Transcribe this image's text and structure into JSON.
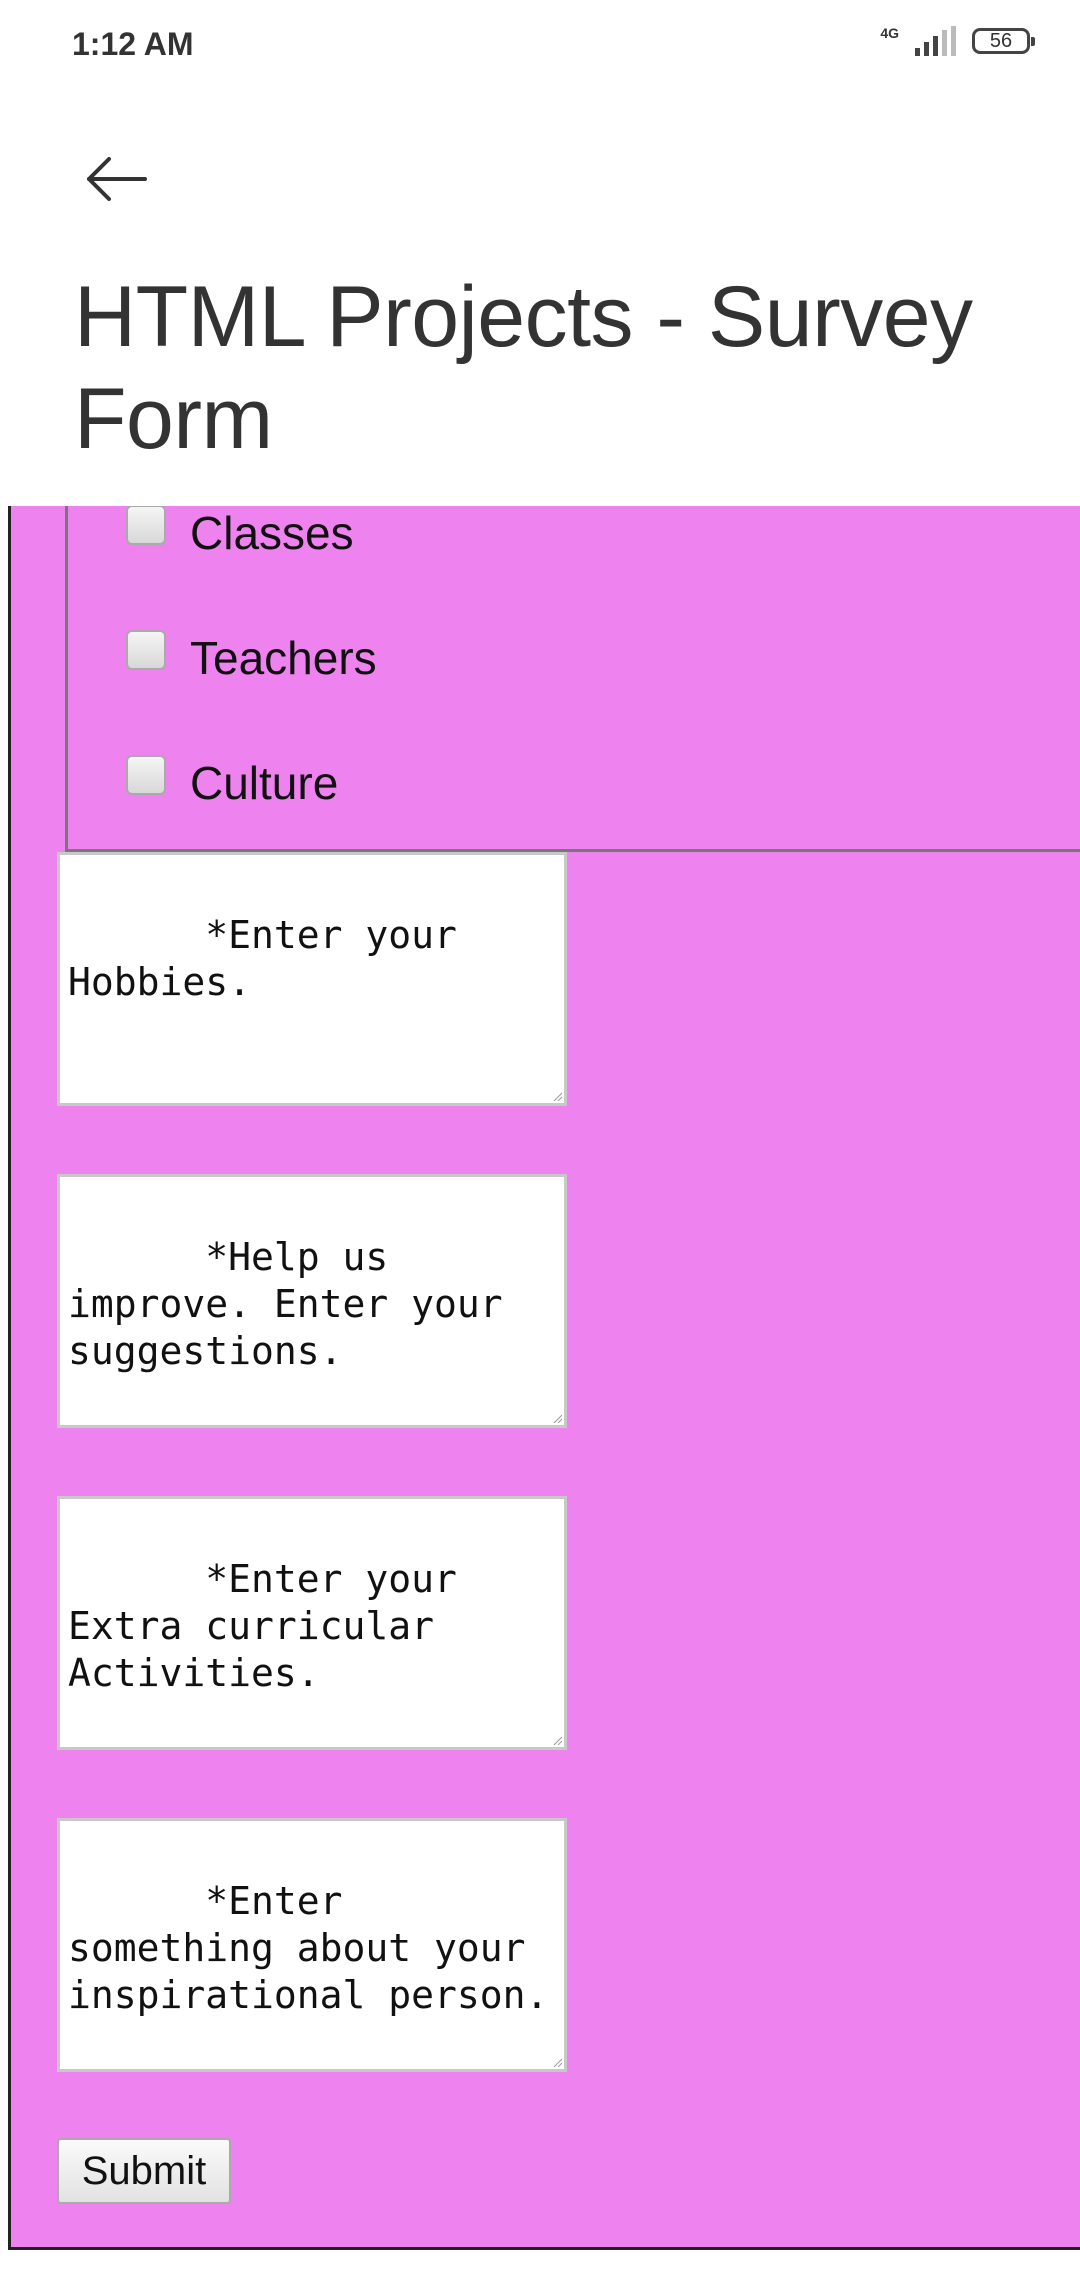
{
  "status_bar": {
    "time": "1:12 AM",
    "network_type": "4G",
    "signal_icon": "signal-bars-icon",
    "battery_level": "56"
  },
  "header": {
    "back_icon": "arrow-left-icon",
    "title": "HTML Projects - Survey Form"
  },
  "form": {
    "background_color": "#ee82ee",
    "checkboxes": [
      {
        "label": "Classes",
        "checked": false
      },
      {
        "label": "Teachers",
        "checked": false
      },
      {
        "label": "Culture",
        "checked": false
      }
    ],
    "textareas": [
      {
        "placeholder": "*Enter your Hobbies.",
        "value": ""
      },
      {
        "placeholder": "*Help us improve. Enter your suggestions.",
        "value": ""
      },
      {
        "placeholder": "*Enter your Extra curricular Activities.",
        "value": ""
      },
      {
        "placeholder": "*Enter something about your inspirational person.",
        "value": ""
      }
    ],
    "submit_label": "Submit"
  }
}
